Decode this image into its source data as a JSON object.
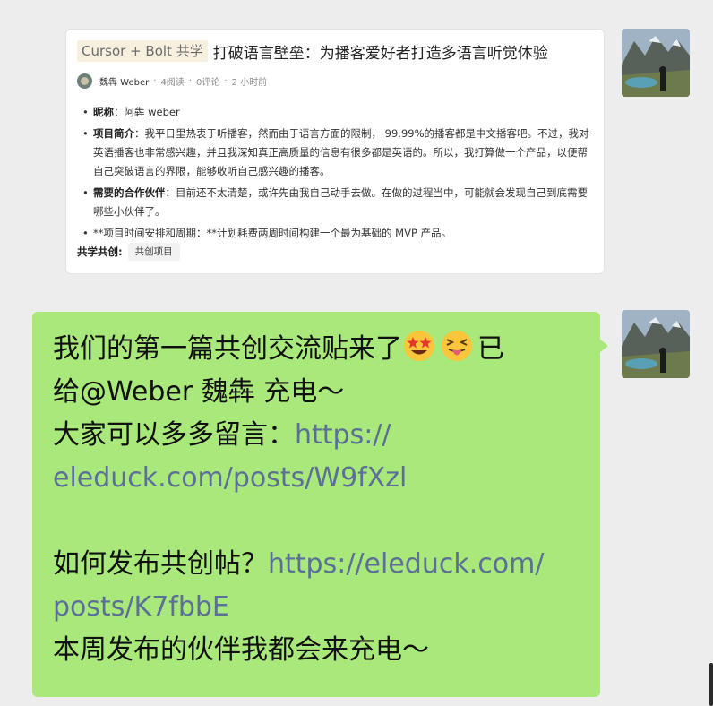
{
  "card": {
    "tag": "Cursor + Bolt 共学",
    "title": "打破语言壁垒：为播客爱好者打造多语言听觉体验",
    "meta": {
      "author": "魏犇 Weber",
      "reads": "4阅读",
      "comments": "0评论",
      "time": "2 小时前"
    },
    "items": [
      {
        "label": "昵称",
        "text": "：阿犇 weber"
      },
      {
        "label": "项目简介",
        "text": "：我平日里热衷于听播客，然而由于语言方面的限制， 99.99%的播客都是中文播客吧。不过，我对英语播客也非常感兴趣，并且我深知真正高质量的信息有很多都是英语的。所以，我打算做一个产品，以便帮自己突破语言的界限，能够收听自己感兴趣的播客。"
      },
      {
        "label": "需要的合作伙伴",
        "text": "：目前还不太清楚，或许先由我自己动手去做。在做的过程当中，可能就会发现自己到底需要哪些小伙伴了。"
      },
      {
        "label": "",
        "text": "**项目时间安排和周期：**计划耗费两周时间构建一个最为基础的 MVP 产品。"
      }
    ],
    "foot_label": "共学共创:",
    "foot_chip": "共创项目"
  },
  "message": {
    "line1": "我们的第一篇共创交流贴来了",
    "line1_tail": "已",
    "line2": "给@Weber 魏犇 充电～",
    "line3_text": "大家可以多多留言：",
    "line3_link": "https://",
    "line4_link": "eleduck.com/posts/W9fXzl",
    "line6_text": "如何发布共创帖？",
    "line6_link": "https://eleduck.com/",
    "line7_link": "posts/K7fbbE",
    "line8": "本周发布的伙伴我都会来充电～",
    "emojis": [
      "star-struck-emoji",
      "squinting-tongue-emoji"
    ]
  },
  "colors": {
    "bubble": "#a9e87a",
    "link": "#5c6f96",
    "background": "#ededed"
  }
}
